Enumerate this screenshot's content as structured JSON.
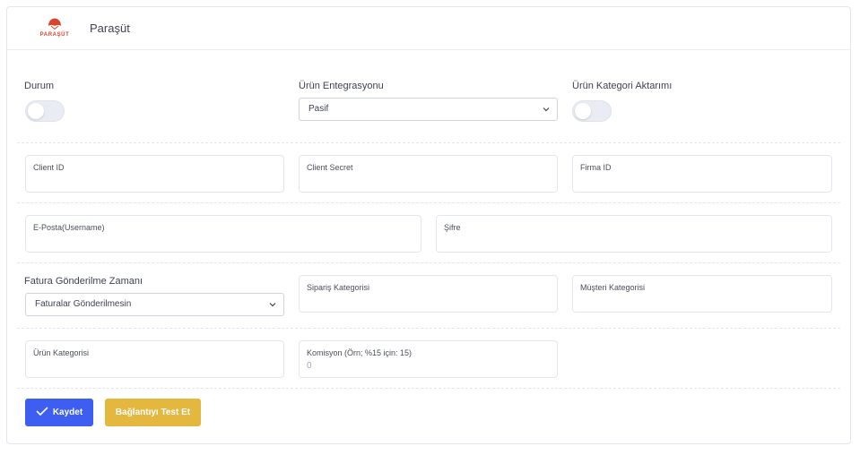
{
  "header": {
    "logo_text": "PARAŞÜT",
    "title": "Paraşüt",
    "brand_color": "#d9442c"
  },
  "toggles": {
    "status_label": "Durum",
    "status_on": false,
    "category_transfer_label": "Ürün Kategori Aktarımı",
    "category_transfer_on": false
  },
  "product_integration": {
    "label": "Ürün Entegrasyonu",
    "selected": "Pasif"
  },
  "credentials": {
    "client_id_label": "Client ID",
    "client_secret_label": "Client Secret",
    "firm_id_label": "Firma ID",
    "email_label": "E-Posta(Username)",
    "password_label": "Şifre"
  },
  "invoice": {
    "label": "Fatura Gönderilme Zamanı",
    "selected": "Faturalar Gönderilmesin"
  },
  "categories": {
    "order_category_label": "Sipariş Kategorisi",
    "customer_category_label": "Müşteri Kategorisi",
    "product_category_label": "Ürün Kategorisi"
  },
  "commission": {
    "label": "Komisyon (Örn; %15 için: 15)",
    "value": "0"
  },
  "actions": {
    "save_label": "Kaydet",
    "test_label": "Bağlantıyı Test Et",
    "primary_color": "#3e5ef2",
    "warning_color": "#e4b73f"
  }
}
